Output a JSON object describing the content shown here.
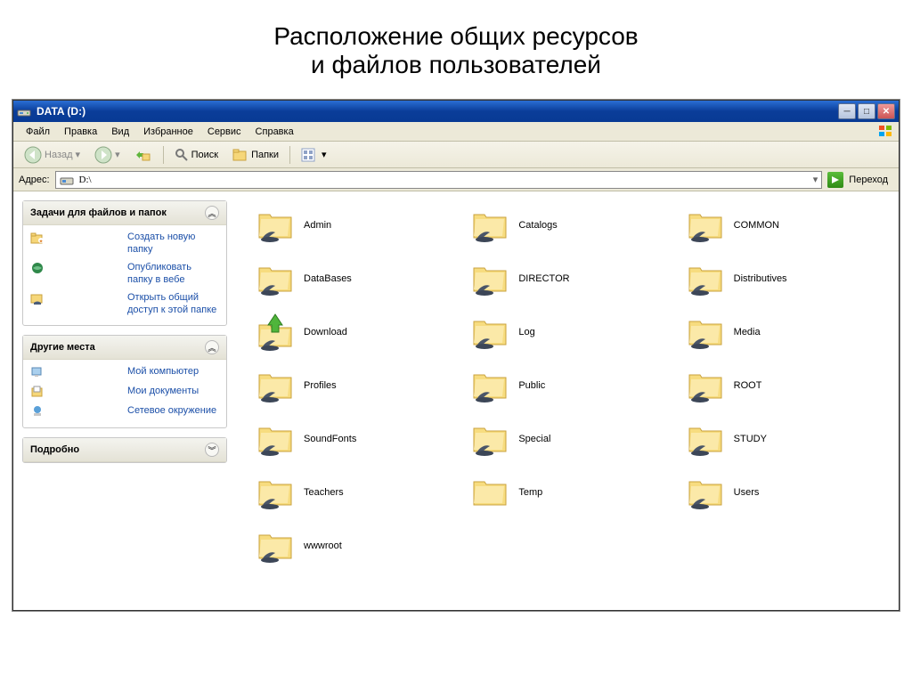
{
  "slide": {
    "title_line1": "Расположение общих ресурсов",
    "title_line2": "и файлов пользователей"
  },
  "window": {
    "title": "DATA (D:)"
  },
  "menu": {
    "file": "Файл",
    "edit": "Правка",
    "view": "Вид",
    "favorites": "Избранное",
    "tools": "Сервис",
    "help": "Справка"
  },
  "toolbar": {
    "back": "Назад",
    "search": "Поиск",
    "folders": "Папки"
  },
  "address": {
    "label": "Адрес:",
    "value": "D:\\",
    "go": "Переход"
  },
  "sidebar": {
    "tasks_header": "Задачи для файлов и папок",
    "tasks": [
      "Создать новую папку",
      "Опубликовать папку в вебе",
      "Открыть общий доступ к этой папке"
    ],
    "places_header": "Другие места",
    "places": [
      "Мой компьютер",
      "Мои документы",
      "Сетевое окружение"
    ],
    "details_header": "Подробно"
  },
  "folders": [
    {
      "name": "Admin",
      "variant": "shared"
    },
    {
      "name": "Catalogs",
      "variant": "shared"
    },
    {
      "name": "COMMON",
      "variant": "shared"
    },
    {
      "name": "DataBases",
      "variant": "shared"
    },
    {
      "name": "DIRECTOR",
      "variant": "shared"
    },
    {
      "name": "Distributives",
      "variant": "shared"
    },
    {
      "name": "Download",
      "variant": "download"
    },
    {
      "name": "Log",
      "variant": "shared"
    },
    {
      "name": "Media",
      "variant": "shared"
    },
    {
      "name": "Profiles",
      "variant": "shared"
    },
    {
      "name": "Public",
      "variant": "shared"
    },
    {
      "name": "ROOT",
      "variant": "shared"
    },
    {
      "name": "SoundFonts",
      "variant": "shared"
    },
    {
      "name": "Special",
      "variant": "shared"
    },
    {
      "name": "STUDY",
      "variant": "shared"
    },
    {
      "name": "Teachers",
      "variant": "shared"
    },
    {
      "name": "Temp",
      "variant": "plain"
    },
    {
      "name": "Users",
      "variant": "shared"
    },
    {
      "name": "wwwroot",
      "variant": "shared"
    }
  ]
}
